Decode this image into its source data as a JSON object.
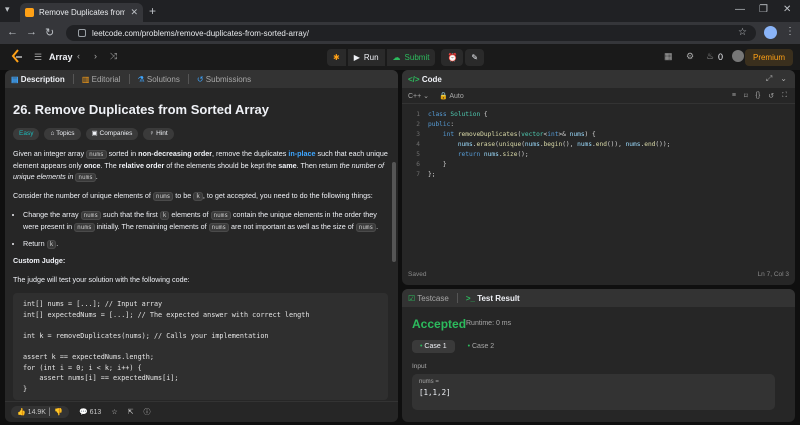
{
  "browser": {
    "tab_title": "Remove Duplicates from Sorte",
    "url": "leetcode.com/problems/remove-duplicates-from-sorted-array/"
  },
  "header": {
    "problem_list": "Array",
    "run_label": "Run",
    "submit_label": "Submit",
    "streak": "0",
    "premium_label": "Premium"
  },
  "left_tabs": [
    "Description",
    "Editorial",
    "Solutions",
    "Submissions"
  ],
  "problem": {
    "title": "26. Remove Duplicates from Sorted Array",
    "tags": [
      "Easy",
      "Topics",
      "Companies",
      "Hint"
    ],
    "consider_text": "Consider the number of unique elements of",
    "custom_judge": "Custom Judge:",
    "judge_text": "The judge will test your solution with the following code:",
    "judge_code": "int[] nums = [...]; // Input array\nint[] expectedNums = [...]; // The expected answer with correct length\n\nint k = removeDuplicates(nums); // Calls your implementation\n\nassert k == expectedNums.length;\nfor (int i = 0; i < k; i++) {\n    assert nums[i] == expectedNums[i];\n}"
  },
  "left_footer": {
    "likes": "14.9K",
    "comments": "613"
  },
  "code_panel": {
    "title": "Code",
    "language": "C++",
    "mode": "Auto",
    "lines": [
      "class Solution {",
      "public:",
      "    int removeDuplicates(vector<int>& nums) {",
      "        nums.erase(unique(nums.begin(), nums.end()), nums.end());",
      "        return nums.size();",
      "    }",
      "};"
    ],
    "status": "Saved",
    "cursor": "Ln 7, Col 3"
  },
  "test_panel": {
    "tab_testcase": "Testcase",
    "tab_result": "Test Result",
    "verdict": "Accepted",
    "runtime": "Runtime: 0 ms",
    "cases": [
      "Case 1",
      "Case 2"
    ],
    "input_label": "Input",
    "var_name": "nums =",
    "var_value": "[1,1,2]"
  },
  "colors": {
    "accepted": "#2cbb5d",
    "brand": "#ffa116",
    "link_blue": "#3ea6ff"
  }
}
